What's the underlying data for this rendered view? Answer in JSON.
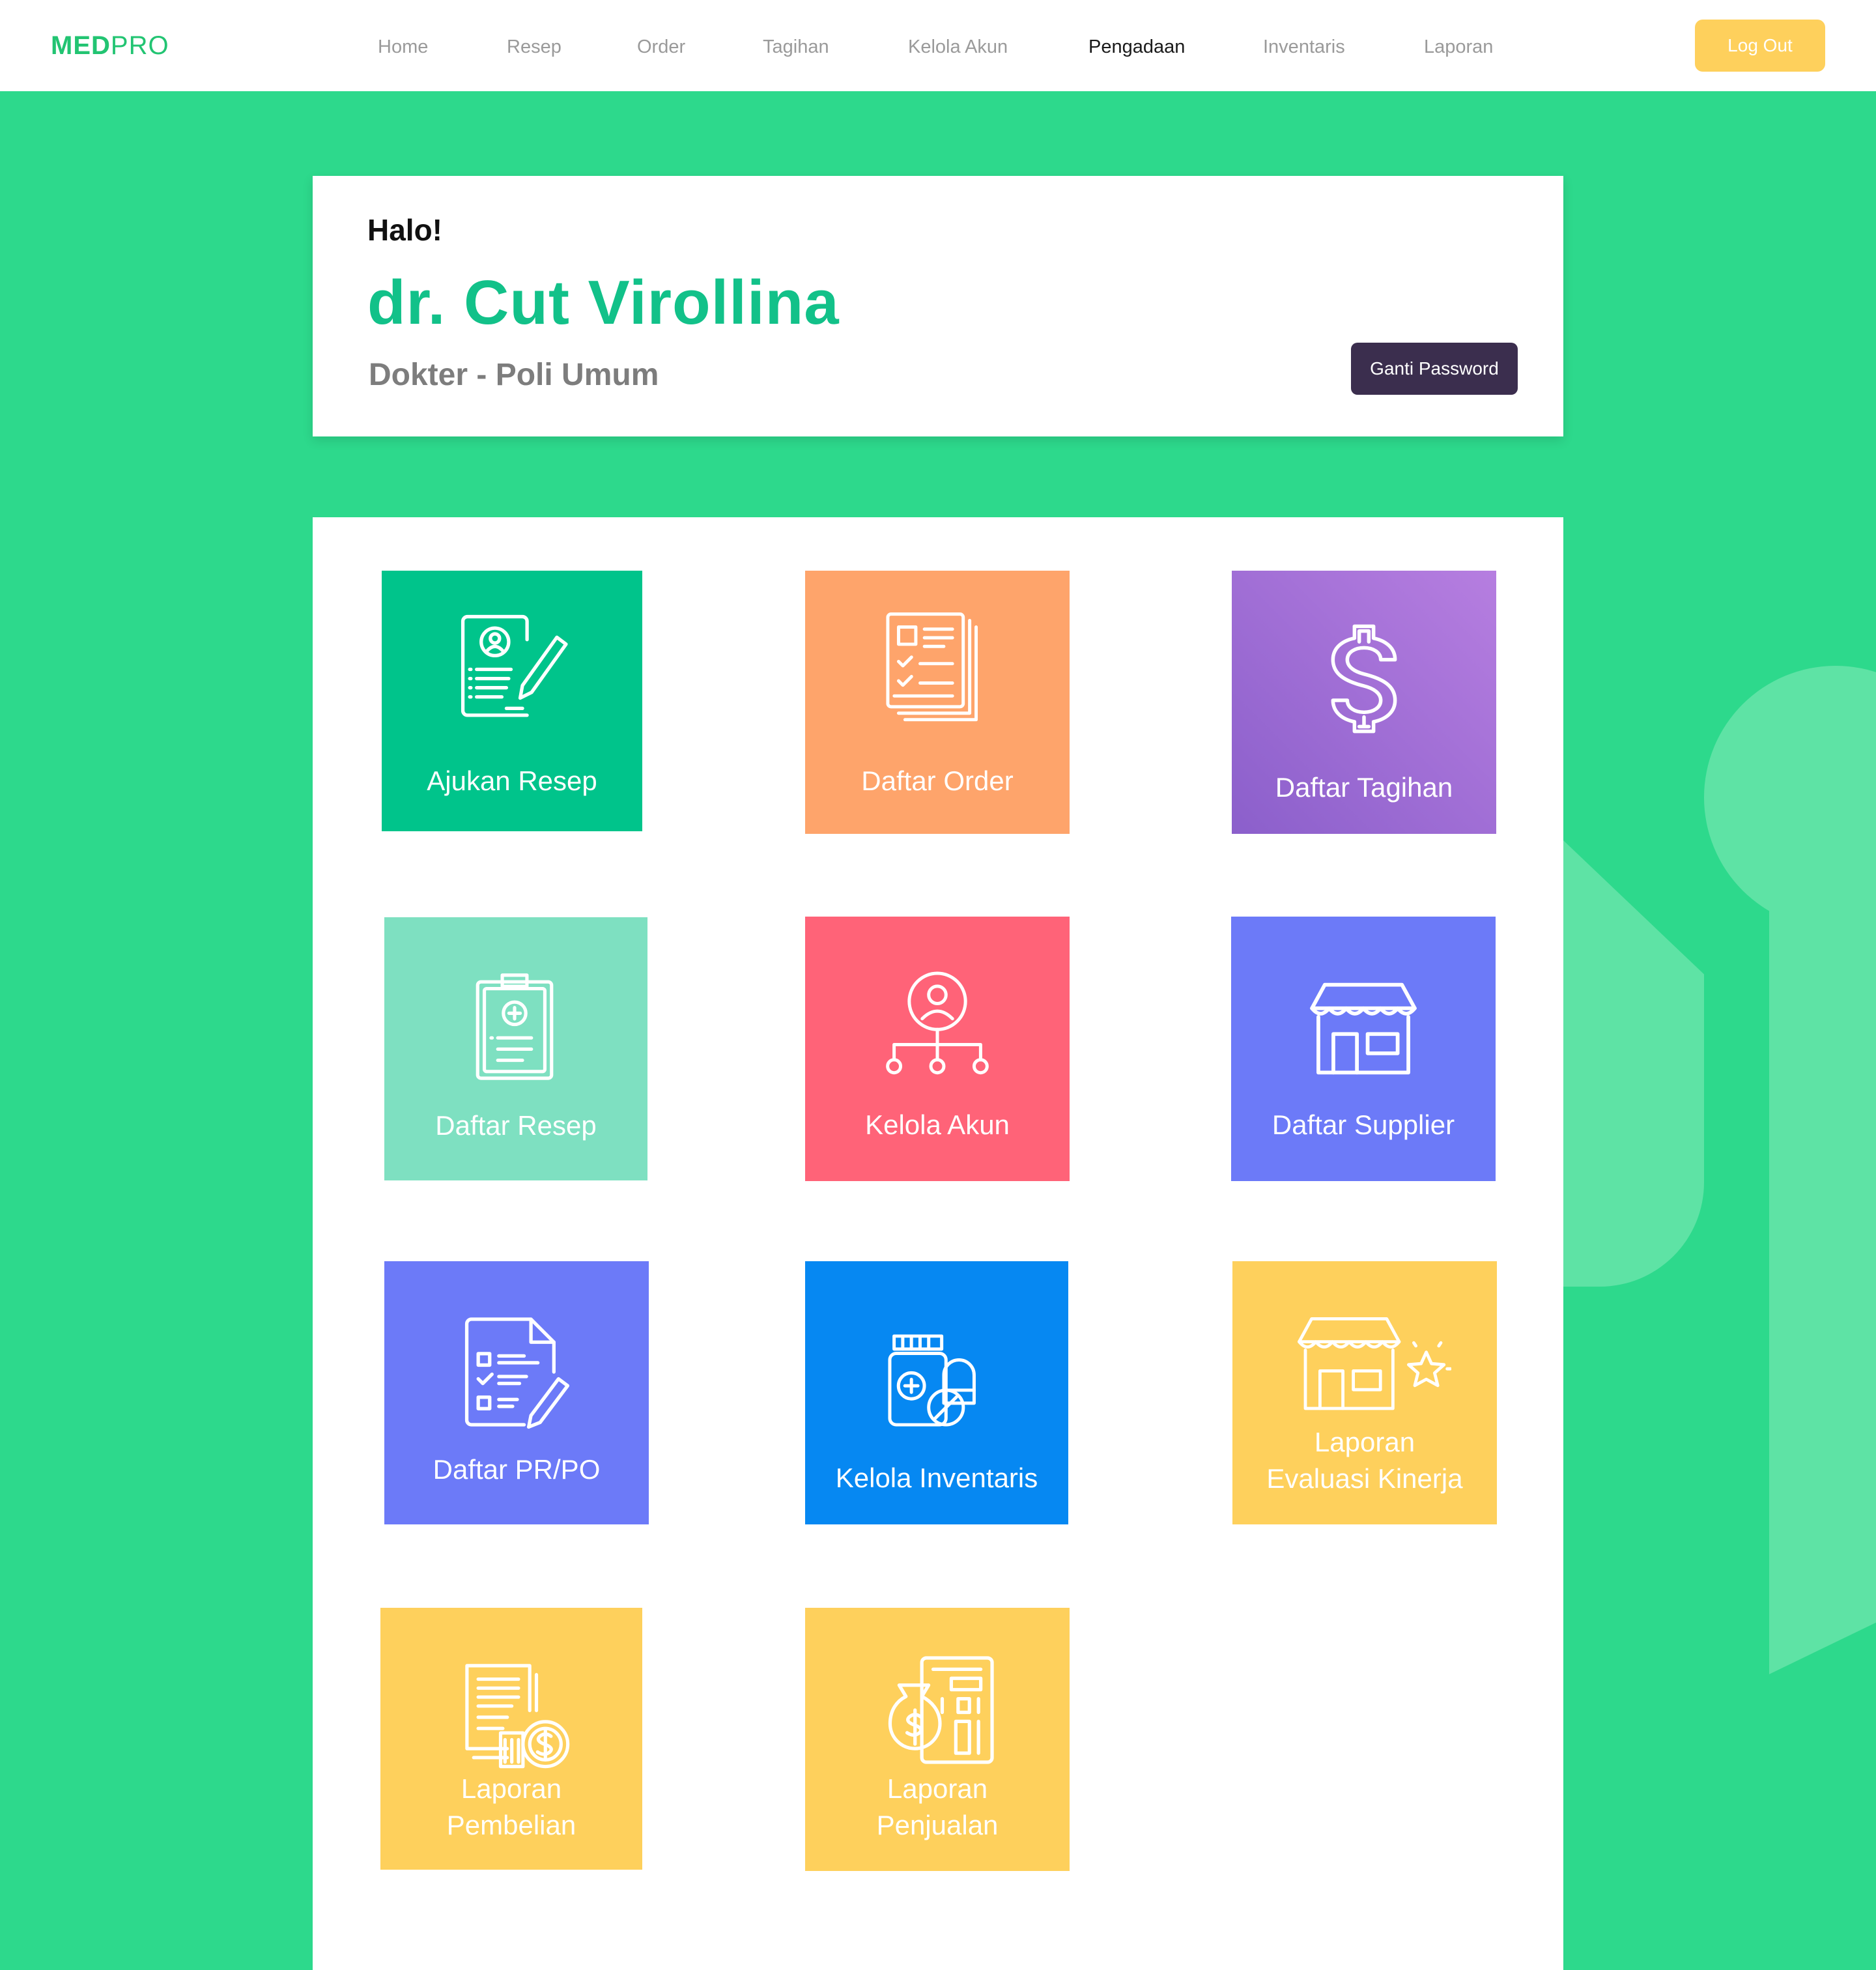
{
  "header": {
    "brand_part1": "MED",
    "brand_part2": "PRO",
    "nav": [
      "Home",
      "Resep",
      "Order",
      "Tagihan",
      "Kelola Akun",
      "Pengadaan",
      "Inventaris",
      "Laporan"
    ],
    "active_nav": "Pengadaan",
    "logout_label": "Log Out"
  },
  "profile": {
    "greeting": "Halo!",
    "name": "dr. Cut Virollina",
    "role": "Dokter - Poli Umum",
    "change_password_label": "Ganti Password"
  },
  "menu": {
    "tiles": [
      {
        "label": "Ajukan Resep",
        "icon": "prescription-form-icon",
        "color": "#00c48b"
      },
      {
        "label": "Daftar Order",
        "icon": "order-list-icon",
        "color": "#fea46b"
      },
      {
        "label": "Daftar Tagihan",
        "icon": "dollar-icon",
        "color": "#9f6fd8"
      },
      {
        "label": "Daftar Resep",
        "icon": "clipboard-medical-icon",
        "color": "#7ee0c1"
      },
      {
        "label": "Kelola Akun",
        "icon": "user-network-icon",
        "color": "#ff6378"
      },
      {
        "label": "Daftar Supplier",
        "icon": "store-icon",
        "color": "#6c7af8"
      },
      {
        "label": "Daftar PR/PO",
        "icon": "checklist-document-icon",
        "color": "#6c7af8"
      },
      {
        "label": "Kelola Inventaris",
        "icon": "medicine-bottle-pill-icon",
        "color": "#0688f2"
      },
      {
        "label_line1": "Laporan",
        "label_line2": "Evaluasi Kinerja",
        "icon": "store-star-icon",
        "color": "#fed05c"
      },
      {
        "label_line1": "Laporan",
        "label_line2": "Pembelian",
        "icon": "purchase-report-icon",
        "color": "#fed05c"
      },
      {
        "label_line1": "Laporan",
        "label_line2": "Penjualan",
        "icon": "sales-calculator-icon",
        "color": "#fed05c"
      }
    ]
  },
  "colors": {
    "background": "#2dd98c",
    "brand": "#22c472",
    "name": "#12c189",
    "logout": "#fed05c",
    "password_button": "#3b2e4e"
  }
}
